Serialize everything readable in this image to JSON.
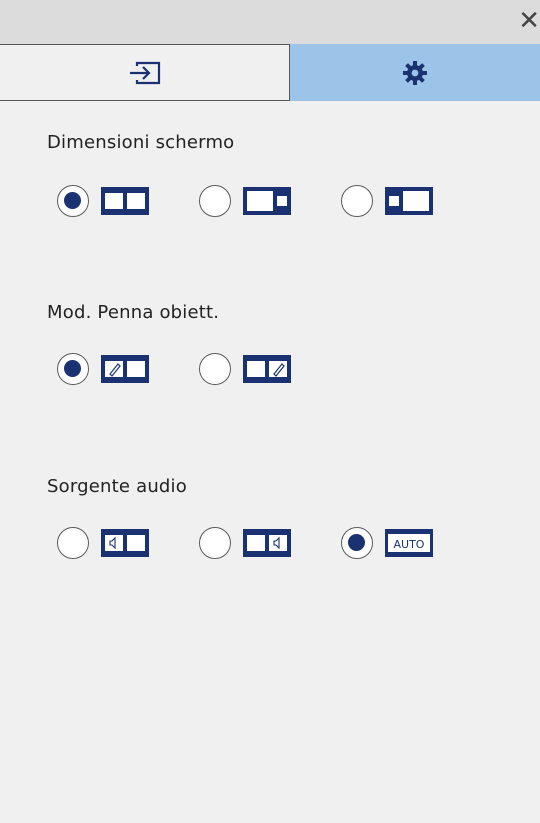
{
  "window": {
    "close_glyph": "✕"
  },
  "tabs": [
    {
      "name": "input-tab",
      "icon": "input-source-icon",
      "selected": false
    },
    {
      "name": "settings-tab",
      "icon": "gear-icon",
      "selected": true
    }
  ],
  "sections": {
    "screen_size": {
      "title": "Dimensioni schermo",
      "options": [
        {
          "icon": "split-equal-icon",
          "selected": true
        },
        {
          "icon": "split-left-large-icon",
          "selected": false
        },
        {
          "icon": "split-right-large-icon",
          "selected": false
        }
      ]
    },
    "pen_mode": {
      "title": "Mod. Penna obiett.",
      "options": [
        {
          "icon": "pen-left-screen-icon",
          "selected": true
        },
        {
          "icon": "pen-right-screen-icon",
          "selected": false
        }
      ]
    },
    "audio_source": {
      "title": "Sorgente audio",
      "options": [
        {
          "icon": "audio-left-screen-icon",
          "selected": false
        },
        {
          "icon": "audio-right-screen-icon",
          "selected": false
        },
        {
          "icon": "audio-auto-icon",
          "selected": true,
          "label": "AUTO"
        }
      ]
    }
  },
  "colors": {
    "accent": "#1a3272",
    "selected_tab": "#9cc3e8",
    "background": "#f0f0f0",
    "title_bar": "#dcdcdc"
  }
}
